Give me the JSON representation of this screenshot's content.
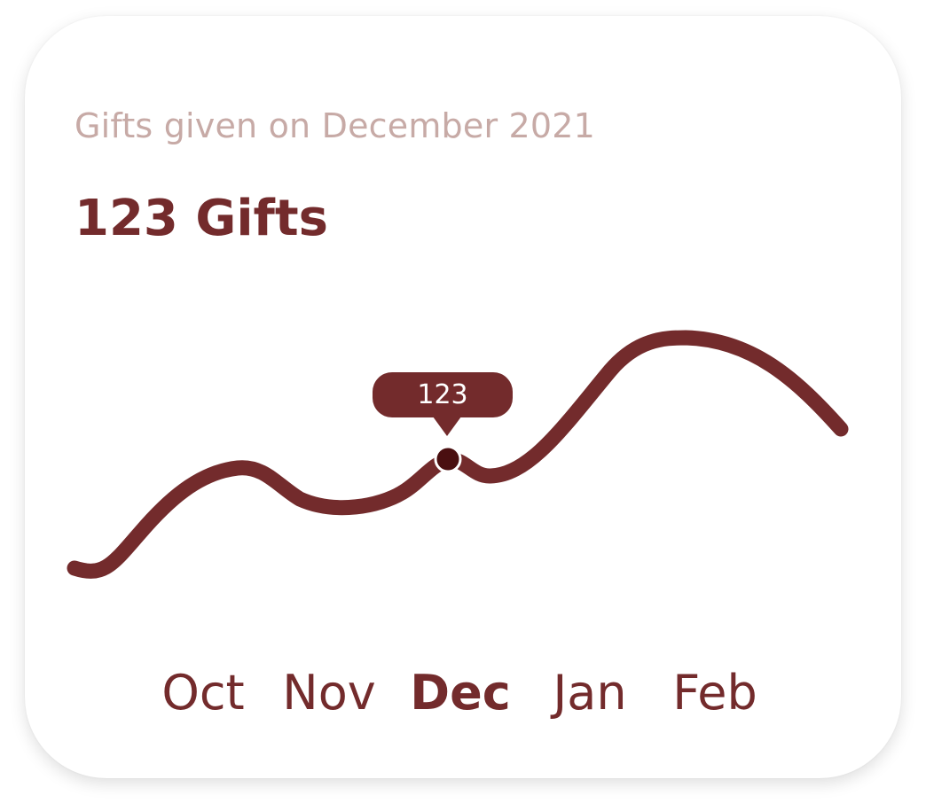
{
  "card": {
    "subtitle": "Gifts given on December 2021",
    "headline": "123 Gifts"
  },
  "tooltip": {
    "value": "123"
  },
  "colors": {
    "line": "#732b2c",
    "subtitle": "#c7aaa6",
    "headline": "#732b2c",
    "point": "#4a0f10"
  },
  "chart_data": {
    "type": "line",
    "title": "",
    "xlabel": "",
    "ylabel": "",
    "categories": [
      "Oct",
      "Nov",
      "Dec",
      "Jan",
      "Feb"
    ],
    "active_category": "Dec",
    "highlight": {
      "category": "Dec",
      "value": 123
    }
  }
}
